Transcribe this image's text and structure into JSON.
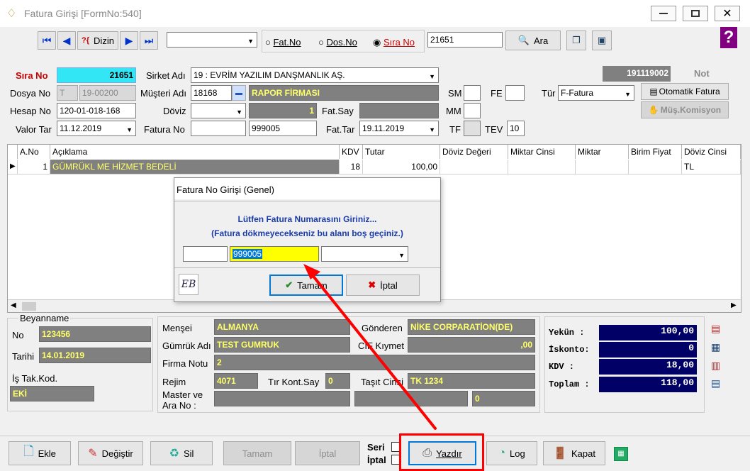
{
  "window": {
    "title": "Fatura Girişi [FormNo:540]"
  },
  "nav": {
    "dizin": "Dizin",
    "search_value": "21651",
    "ara": "Ara",
    "radio_fatno": "Fat.No",
    "radio_dosno": "Dos.No",
    "radio_sirano": "Sıra No"
  },
  "header": {
    "sira_no_label": "Sıra No",
    "sira_no": "21651",
    "sirket_label": "Sirket Adı",
    "sirket": "19 : EVRİM YAZILIM DANŞMANLIK AŞ.",
    "code_badge": "191119002",
    "not_label": "Not",
    "dosya_label": "Dosya No",
    "dosya_prefix": "T",
    "dosya_no": "19-00200",
    "musteri_label": "Müşteri Adı",
    "musteri_kod": "18168",
    "musteri_ad": "RAPOR FİRMASI",
    "sm_label": "SM",
    "fe_label": "FE",
    "tur_label": "Tür",
    "tur": "F-Fatura",
    "otomatik_fatura": "Otomatik Fatura",
    "mus_komisyon": "Müş.Komisyon",
    "hesap_label": "Hesap No",
    "hesap_no": "120-01-018-168",
    "doviz_label": "Döviz",
    "kur": "1",
    "fat_say_label": "Fat.Say",
    "mm_label": "MM",
    "valor_label": "Valor Tar",
    "valor_tar": "11.12.2019",
    "fatura_no_label": "Fatura No",
    "fatura_no": "999005",
    "fat_tar_label": "Fat.Tar",
    "fat_tar": "19.11.2019",
    "tf_label": "TF",
    "tev_label": "TEV",
    "tev": "10"
  },
  "grid": {
    "columns": [
      "A.No",
      "Açıklama",
      "KDV",
      "Tutar",
      "Döviz Değeri",
      "Miktar Cinsi",
      "Miktar",
      "Birim Fiyat",
      "Döviz Cinsi"
    ],
    "rows": [
      {
        "ano": "1",
        "aciklama": "GÜMRÜKL ME HİZMET BEDELİ",
        "kdv": "18",
        "tutar": "100,00",
        "doviz_degeri": "",
        "miktar_cinsi": "",
        "miktar": "",
        "birim_fiyat": "",
        "doviz_cinsi": "TL"
      }
    ]
  },
  "dialog": {
    "title": "Fatura No Girişi (Genel)",
    "line1": "Lütfen Fatura Numarasını Giriniz...",
    "line2": "(Fatura dökmeyecekseniz bu alanı boş geçiniz.)",
    "value": "999005",
    "ok": "Tamam",
    "cancel": "İptal"
  },
  "beyanname": {
    "title": "Beyanname",
    "no_label": "No",
    "no": "123456",
    "tarih_label": "Tarihi",
    "tarih": "14.01.2019",
    "istak_label": "İş Tak.Kod.",
    "istak": "EKİ"
  },
  "details": {
    "mensei_label": "Menşei",
    "mensei": "ALMANYA",
    "gonderen_label": "Gönderen",
    "gonderen": "NİKE CORPARATİON(DE)",
    "gumruk_label": "Gümrük Adı",
    "gumruk": "TEST GUMRUK",
    "cif_label": "CIF Kıymet",
    "cif": ",00",
    "firma_notu_label": "Firma Notu",
    "firma_notu": "2",
    "rejim_label": "Rejim",
    "rejim": "4071",
    "tir_label": "Tır Kont.Say",
    "tir": "0",
    "tasit_label": "Taşıt Cinsi",
    "tasit": "TK 1234",
    "master_label": "Master ve Ara No :",
    "master_val": "0"
  },
  "totals": {
    "yekun_label": "Yekün   :",
    "yekun": "100,00",
    "iskonto_label": "İskonto:",
    "iskonto": "0",
    "kdv_label": "KDV     :",
    "kdv": "18,00",
    "toplam_label": "Toplam  :",
    "toplam": "118,00"
  },
  "bottom": {
    "ekle": "Ekle",
    "degistir": "Değiştir",
    "sil": "Sil",
    "tamam": "Tamam",
    "iptal": "İptal",
    "seri": "Seri",
    "iptal_chk": "İptal",
    "yazdir": "Yazdır",
    "log": "Log",
    "kapat": "Kapat"
  },
  "colors": {
    "highlight_cyan": "#33e6f5",
    "annotation_red": "#ff0000",
    "navy": "#000066"
  }
}
